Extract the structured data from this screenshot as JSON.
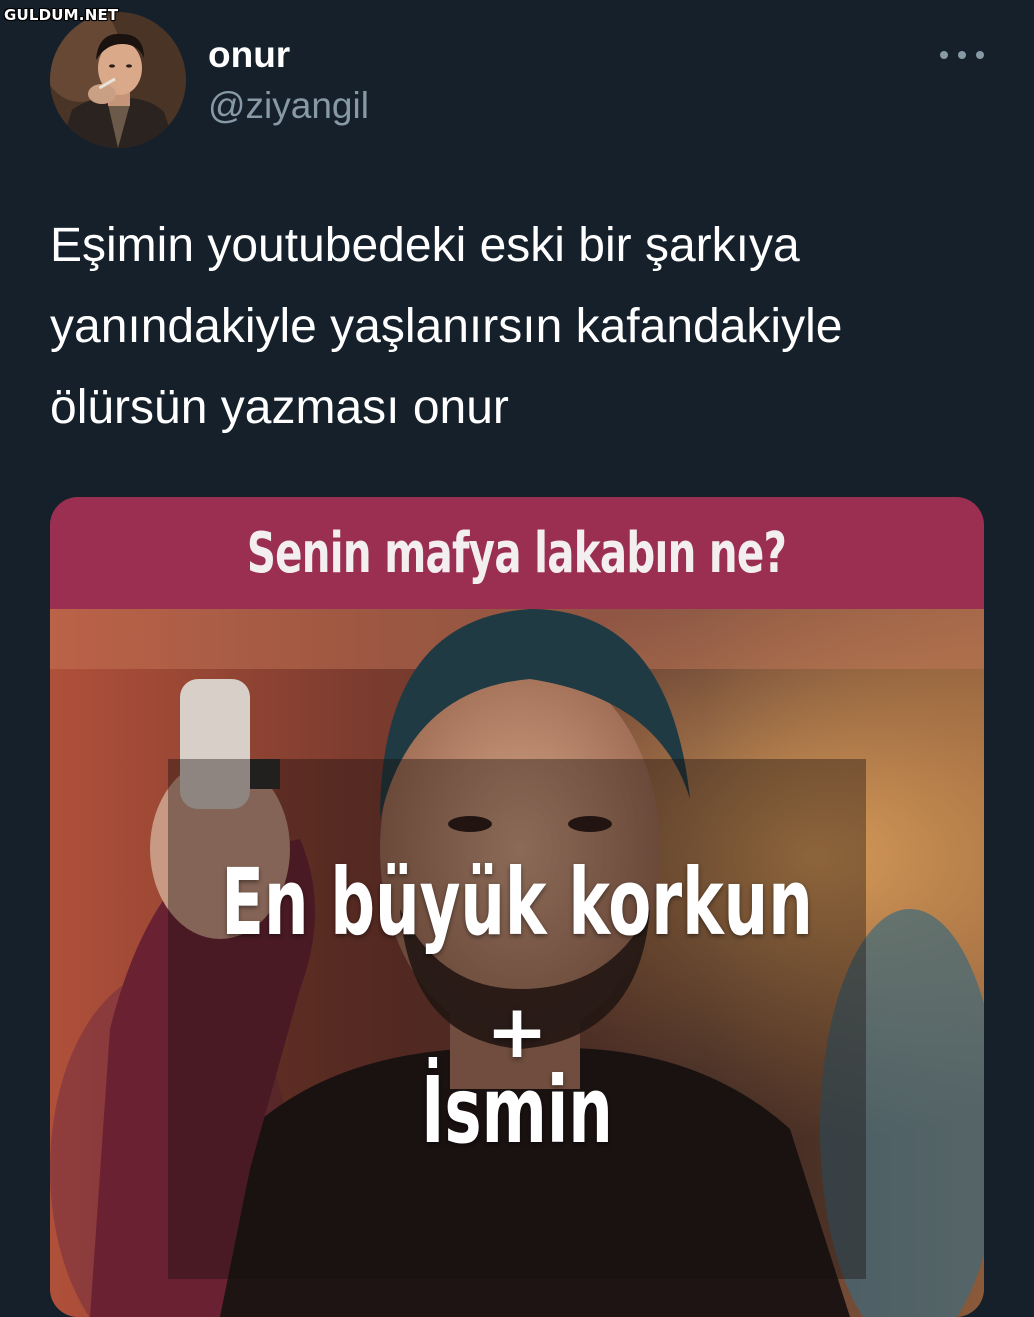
{
  "watermark": "GULDUM.NET",
  "tweet": {
    "author_name": "onur",
    "author_handle": "@ziyangil",
    "more_icon": "more-horizontal-icon",
    "text_lines": [
      "Eşimin youtubedeki eski bir şarkıya",
      "yanındakiyle yaşlanırsın kafandakiyle",
      "ölürsün yazması onur"
    ]
  },
  "media": {
    "header_text": "Senin mafya lakabın ne?",
    "overlay_line1": "En büyük korkun",
    "overlay_plus": "+",
    "overlay_line2": "İsmin"
  },
  "colors": {
    "background": "#15202b",
    "secondary_text": "#8899a6",
    "media_header": "#9b2f52"
  }
}
